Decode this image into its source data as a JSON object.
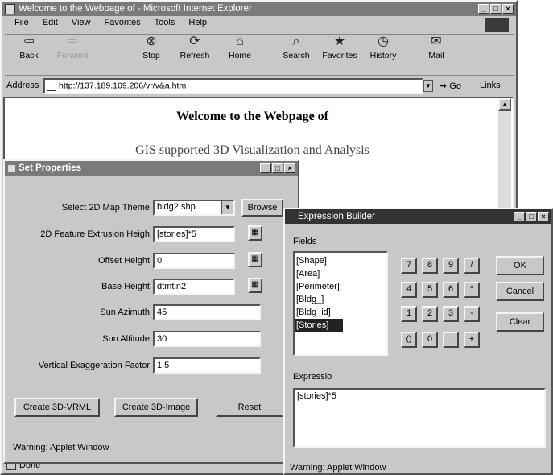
{
  "browser": {
    "title": "Welcome to the Webpage of - Microsoft Internet Explorer",
    "menu": [
      "File",
      "Edit",
      "View",
      "Favorites",
      "Tools",
      "Help"
    ],
    "toolbar": [
      {
        "label": "Back",
        "icon": "back-arrow-icon",
        "glyph": "⇦"
      },
      {
        "label": "Forward",
        "icon": "forward-arrow-icon",
        "glyph": "⇨"
      },
      {
        "label": "Stop",
        "icon": "stop-icon",
        "glyph": "⊗"
      },
      {
        "label": "Refresh",
        "icon": "refresh-icon",
        "glyph": "⟳"
      },
      {
        "label": "Home",
        "icon": "home-icon",
        "glyph": "⌂"
      },
      {
        "label": "Search",
        "icon": "search-icon",
        "glyph": "⌕"
      },
      {
        "label": "Favorites",
        "icon": "favorites-icon",
        "glyph": "★"
      },
      {
        "label": "History",
        "icon": "history-icon",
        "glyph": "◷"
      },
      {
        "label": "Mail",
        "icon": "mail-icon",
        "glyph": "✉"
      }
    ],
    "address_label": "Address",
    "address_value": "http://137.189.169.206/vr/v&a.htm",
    "go_label": "Go",
    "links_label": "Links",
    "status": "Done"
  },
  "page": {
    "heading": "Welcome to the Webpage of",
    "subheading": "GIS supported 3D Visualization and Analysis"
  },
  "set_properties": {
    "title": "Set Properties",
    "rows": [
      {
        "label": "Select 2D Map Theme",
        "value": "bldg2.shp"
      },
      {
        "label": "2D Feature Extrusion Heigh",
        "value": "[stories]*5"
      },
      {
        "label": "Offset Height",
        "value": "0"
      },
      {
        "label": "Base Height",
        "value": "dtmtin2"
      },
      {
        "label": "Sun Azimuth",
        "value": "45"
      },
      {
        "label": "Sun Altitude",
        "value": "30"
      },
      {
        "label": "Vertical Exaggeration Factor",
        "value": "1.5"
      }
    ],
    "browse_label": "Browse",
    "create_vrml_label": "Create 3D-VRML",
    "create_image_label": "Create 3D-Image",
    "reset_label": "Reset",
    "warning": "Warning: Applet Window"
  },
  "expression_builder": {
    "title": "Expression Builder",
    "fields_label": "Fields",
    "fields": [
      "[Shape]",
      "[Area]",
      "[Perimeter]",
      "[Bldg_]",
      "[Bldg_id]",
      "[Stories]"
    ],
    "selected_field": "[Stories]",
    "keys": [
      [
        "7",
        "8",
        "9",
        "/"
      ],
      [
        "4",
        "5",
        "6",
        "*"
      ],
      [
        "1",
        "2",
        "3",
        "-"
      ],
      [
        "()",
        "0",
        ".",
        "+"
      ]
    ],
    "ok_label": "OK",
    "cancel_label": "Cancel",
    "clear_label": "Clear",
    "expression_label": "Expressio",
    "expression_value": "[stories]*5",
    "warning": "Warning: Applet Window"
  }
}
